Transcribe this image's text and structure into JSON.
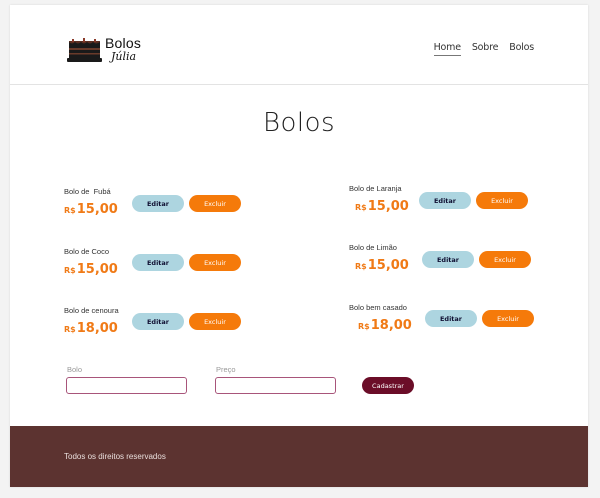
{
  "brand": {
    "title": "Bolos",
    "subtitle": "Júlia"
  },
  "nav": {
    "items": [
      "Home",
      "Sobre",
      "Bolos"
    ],
    "active": "Home"
  },
  "page_title": "Bolos",
  "cakes": [
    {
      "name": "Bolo de  Fubá",
      "currency": "R$",
      "price": "15,00"
    },
    {
      "name": "Bolo de Laranja",
      "currency": "R$",
      "price": "15,00"
    },
    {
      "name": "Bolo de Coco",
      "currency": "R$",
      "price": "15,00"
    },
    {
      "name": "Bolo de Limão",
      "currency": "R$",
      "price": "15,00"
    },
    {
      "name": "Bolo de cenoura",
      "currency": "R$",
      "price": "18,00"
    },
    {
      "name": "Bolo bem casado",
      "currency": "R$",
      "price": "18,00"
    }
  ],
  "buttons": {
    "edit": "Editar",
    "delete": "Excluir"
  },
  "form": {
    "cake_label": "Bolo",
    "price_label": "Preço",
    "submit": "Cadastrar",
    "cake_value": "",
    "price_value": ""
  },
  "footer": {
    "text": "Todos os direitos reservados"
  },
  "colors": {
    "accent": "#f57a0a",
    "edit": "#add5e0",
    "submit": "#6b0d28",
    "footer": "#5c3330",
    "input_border": "#a8557a"
  },
  "icons": {
    "logo": "cake-icon"
  }
}
